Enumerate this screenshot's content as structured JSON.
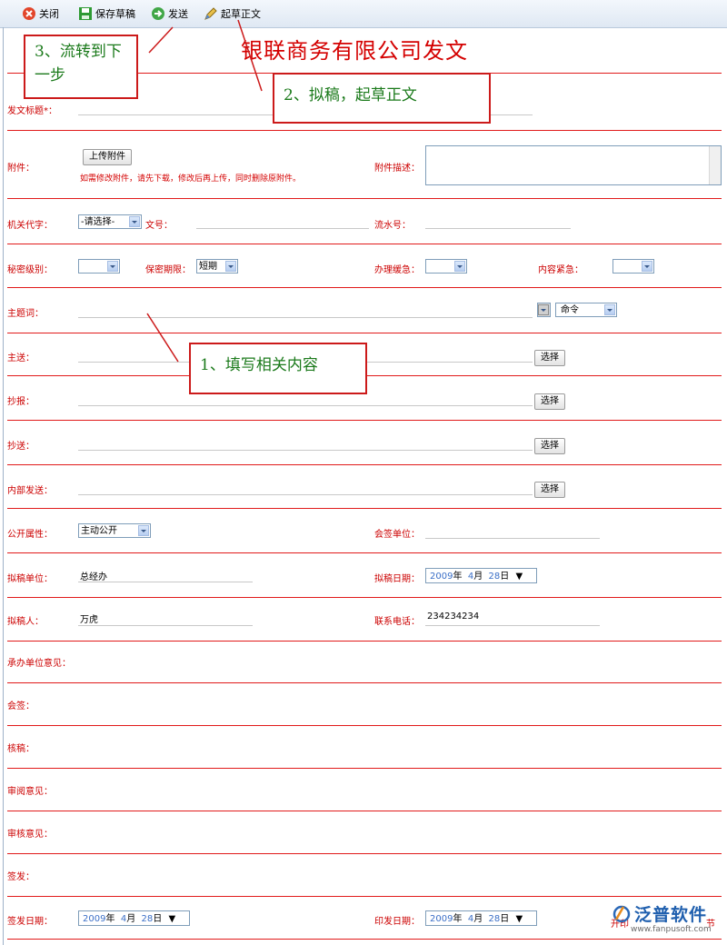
{
  "toolbar": {
    "close": "关闭",
    "save_draft": "保存草稿",
    "send": "发送",
    "draft_body": "起草正文"
  },
  "form": {
    "title": "银联商务有限公司发文",
    "subject_label": "发文标题*：",
    "attachment_label": "附件：",
    "upload_button": "上传附件",
    "attachment_note": "如需修改附件，请先下载，修改后再上传，同时删除原附件。",
    "attachment_desc_label": "附件描述：",
    "org_code_label": "机关代字：",
    "org_code_value": "-请选择-",
    "doc_no_label": "文号：",
    "serial_no_label": "流水号：",
    "secret_level_label": "秘密级别：",
    "secret_period_label": "保密期限：",
    "secret_period_value": "短期",
    "handling_speed_label": "办理缓急：",
    "content_urgency_label": "内容紧急：",
    "keyword_label": "主题词：",
    "keyword_type_value": "命令",
    "main_to_label": "主送：",
    "report_to_label": "抄报：",
    "copy_to_label": "抄送：",
    "internal_send_label": "内部发送：",
    "choose_button": "选择",
    "public_attr_label": "公开属性：",
    "public_attr_value": "主动公开",
    "countersign_unit_label": "会签单位：",
    "draft_unit_label": "拟稿单位：",
    "draft_unit_value": "总经办",
    "draft_date_label": "拟稿日期：",
    "drafter_label": "拟稿人：",
    "drafter_value": "万虎",
    "phone_label": "联系电话：",
    "phone_value": "234234234",
    "undertaker_opinion_label": "承办单位意见：",
    "countersign_label": "会签：",
    "review_label": "核稿：",
    "read_opinion_label": "审阅意见：",
    "audit_opinion_label": "审核意见：",
    "issue_label": "签发：",
    "issue_date_label": "签发日期：",
    "print_date_label": "印发日期：",
    "date": {
      "year": "2009",
      "year_unit": "年",
      "month": "4",
      "month_unit": "月",
      "day": "28",
      "day_unit": "日",
      "dropdown": "▼"
    },
    "bottom_left_text": "开印",
    "bottom_right_text": "节"
  },
  "callouts": {
    "step3": "3、流转到下一步",
    "step2": "2、拟稿，起草正文",
    "step1": "1、填写相关内容"
  },
  "watermark": {
    "brand": "泛普软件",
    "url": "www.fanpusoft.com"
  },
  "colors": {
    "accent_red": "#cc0000",
    "callout_text": "#1b7a1b"
  }
}
